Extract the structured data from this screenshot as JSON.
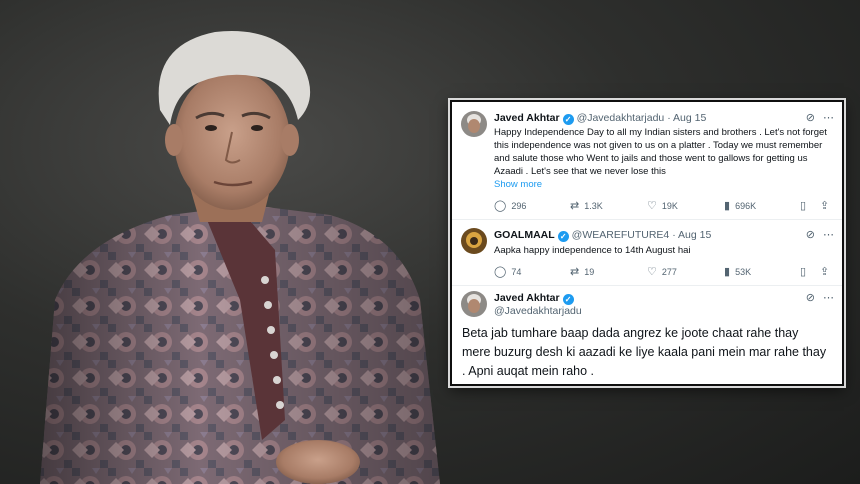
{
  "tweets": [
    {
      "name": "Javed Akhtar",
      "handle": "@Javedakhtarjadu",
      "dot": "·",
      "date": "Aug 15",
      "text": "Happy Independence Day  to all my Indian sisters and brothers  . Let's not forget this independence was not given to us on a platter . Today we must remember and salute those who Went to jails and those went to gallows for getting us Azaadi . Let's see that we never lose this",
      "show_more": "Show more",
      "replies": "296",
      "reposts": "1.3K",
      "likes": "19K",
      "views": "696K"
    },
    {
      "name": "GOALMAAL",
      "handle": "@WEAREFUTURE4",
      "dot": "·",
      "date": "Aug 15",
      "text": "Aapka happy independence to 14th August hai",
      "replies": "74",
      "reposts": "19",
      "likes": "277",
      "views": "53K"
    },
    {
      "name": "Javed Akhtar",
      "handle": "@Javedakhtarjadu",
      "text": "Beta jab tumhare baap dada angrez ke joote chaat rahe thay mere buzurg desh ki aazadi ke liye kaala pani mein mar rahe thay . Apni auqat mein raho ."
    }
  ],
  "icons": {
    "verified": "verified-badge",
    "grok": "grok-icon",
    "more": "more-icon",
    "reply": "reply-icon",
    "repost": "repost-icon",
    "like": "like-icon",
    "views": "views-icon",
    "bookmark": "bookmark-icon",
    "share": "share-icon"
  },
  "colors": {
    "accent": "#1d9bf0",
    "text": "#0f1419",
    "secondary": "#536471"
  }
}
